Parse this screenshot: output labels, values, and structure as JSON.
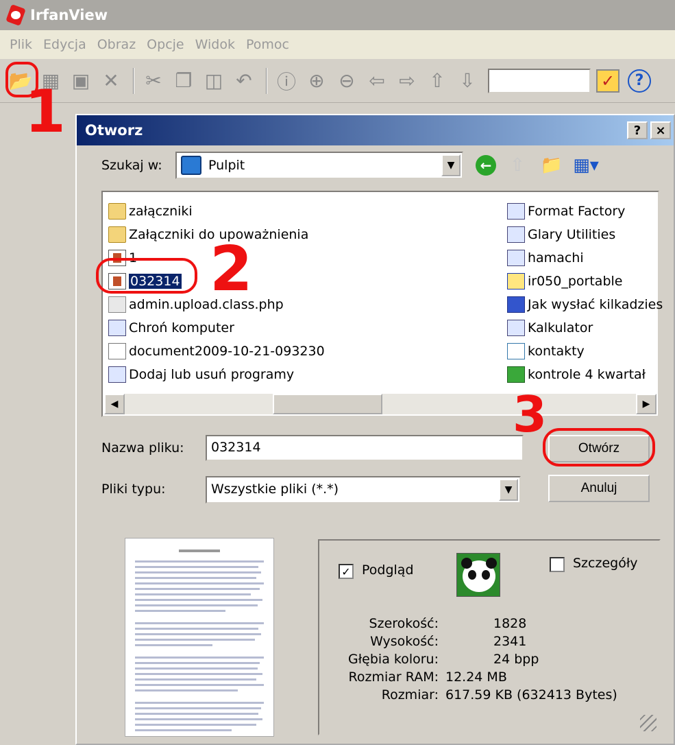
{
  "app": {
    "title": "IrfanView",
    "menu": [
      "Plik",
      "Edycja",
      "Obraz",
      "Opcje",
      "Widok",
      "Pomoc"
    ]
  },
  "annotations": {
    "one": "1",
    "two": "2",
    "three": "3"
  },
  "dialog": {
    "title": "Otworz",
    "help_label": "?",
    "close_label": "×",
    "lookin_label": "Szukaj w:",
    "lookin_value": "Pulpit",
    "files_left": [
      {
        "name": "załączniki",
        "icon": "folder"
      },
      {
        "name": "Załączniki do upoważnienia",
        "icon": "folder"
      },
      {
        "name": "1",
        "icon": "img"
      },
      {
        "name": "032314",
        "icon": "img",
        "selected": true
      },
      {
        "name": "admin.upload.class.php",
        "icon": "php"
      },
      {
        "name": "Chroń komputer",
        "icon": "shortcut"
      },
      {
        "name": "document2009-10-21-093230",
        "icon": "doc"
      },
      {
        "name": "Dodaj lub usuń programy",
        "icon": "shortcut"
      }
    ],
    "files_right": [
      {
        "name": "Format Factory",
        "icon": "shortcut"
      },
      {
        "name": "Glary Utilities",
        "icon": "shortcut"
      },
      {
        "name": "hamachi",
        "icon": "shortcut"
      },
      {
        "name": "ir050_portable",
        "icon": "zip"
      },
      {
        "name": "Jak wysłać kilkadzies",
        "icon": "word"
      },
      {
        "name": "Kalkulator",
        "icon": "shortcut"
      },
      {
        "name": "kontakty",
        "icon": "vcf"
      },
      {
        "name": "kontrole 4 kwartał",
        "icon": "excel"
      }
    ],
    "filename_label": "Nazwa pliku:",
    "filename_value": "032314",
    "type_label": "Pliki typu:",
    "type_value": "Wszystkie pliki (*.*)",
    "open_label": "Otwórz",
    "cancel_label": "Anuluj",
    "preview_label": "Podgląd",
    "preview_checked": true,
    "details_label": "Szczegóły",
    "details_checked": false,
    "info": [
      {
        "key": "Szerokość:",
        "value": "1828"
      },
      {
        "key": "Wysokość:",
        "value": "2341"
      },
      {
        "key": "Głębia koloru:",
        "value": "24 bpp"
      },
      {
        "key": "Rozmiar RAM:",
        "value": "12.24 MB"
      },
      {
        "key": "Rozmiar:",
        "value": "617.59 KB (632413 Bytes)"
      }
    ]
  },
  "colors": {
    "selection": "#0a246a",
    "annotation": "#ee1111",
    "dialog_bg": "#d4d0c8"
  }
}
